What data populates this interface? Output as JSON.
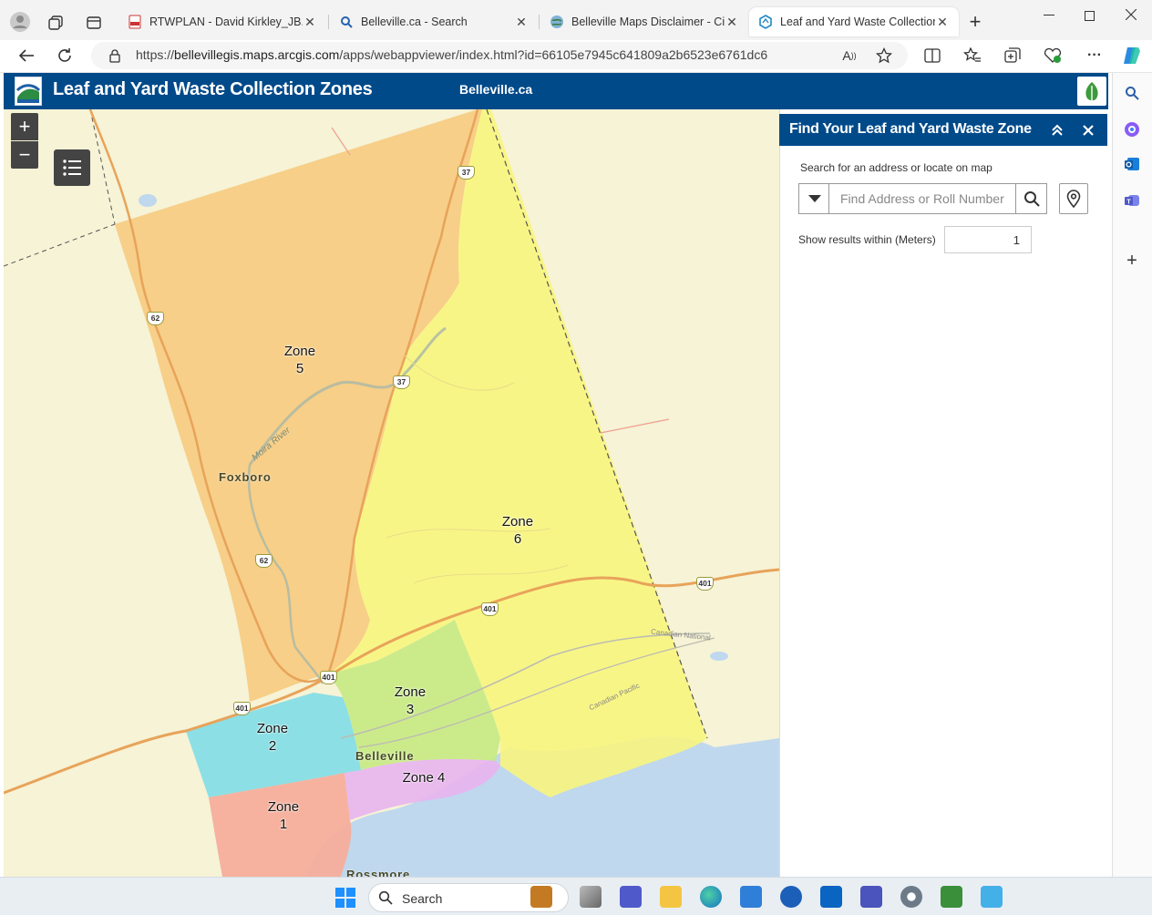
{
  "browser": {
    "tabs": [
      {
        "label": "RTWPLAN - David Kirkley_JB.p",
        "favicon": "pdf-icon",
        "active": false
      },
      {
        "label": "Belleville.ca - Search",
        "favicon": "search-icon",
        "active": false
      },
      {
        "label": "Belleville Maps Disclaimer - City",
        "favicon": "globe-icon",
        "active": false
      },
      {
        "label": "Leaf and Yard Waste Collection",
        "favicon": "arcgis-icon",
        "active": true
      }
    ],
    "url_prefix": "https://",
    "url_host": "bellevillegis.maps.arcgis.com",
    "url_path": "/apps/webappviewer/index.html?id=66105e7945c641809a2b6523e6761dc6"
  },
  "app": {
    "title": "Leaf and Yard Waste Collection Zones",
    "link": "Belleville.ca"
  },
  "map": {
    "zones": [
      {
        "name": "Zone",
        "num": "5",
        "color": "#f7c87a"
      },
      {
        "name": "Zone",
        "num": "6",
        "color": "#f8f57e"
      },
      {
        "name": "Zone",
        "num": "3",
        "color": "#c7ea83"
      },
      {
        "name": "Zone",
        "num": "2",
        "color": "#86dde6"
      },
      {
        "name": "Zone",
        "num": "1",
        "color": "#f6ae9c"
      },
      {
        "name": "Zone 4",
        "num": "",
        "color": "#e8b4ee"
      }
    ],
    "places": [
      "Foxboro",
      "Belleville",
      "Rossmore"
    ],
    "river": "Moira River",
    "railways": [
      "Canadian National",
      "Canadian Pacific"
    ],
    "highways": [
      "37",
      "37",
      "62",
      "62",
      "401",
      "401",
      "401",
      "401"
    ]
  },
  "panel": {
    "title": "Find Your Leaf and Yard Waste Zone",
    "hint": "Search for an address or locate on map",
    "search_placeholder": "Find Address or Roll Number",
    "within_label": "Show results within (Meters)",
    "within_value": "1"
  },
  "taskbar": {
    "search_label": "Search"
  }
}
